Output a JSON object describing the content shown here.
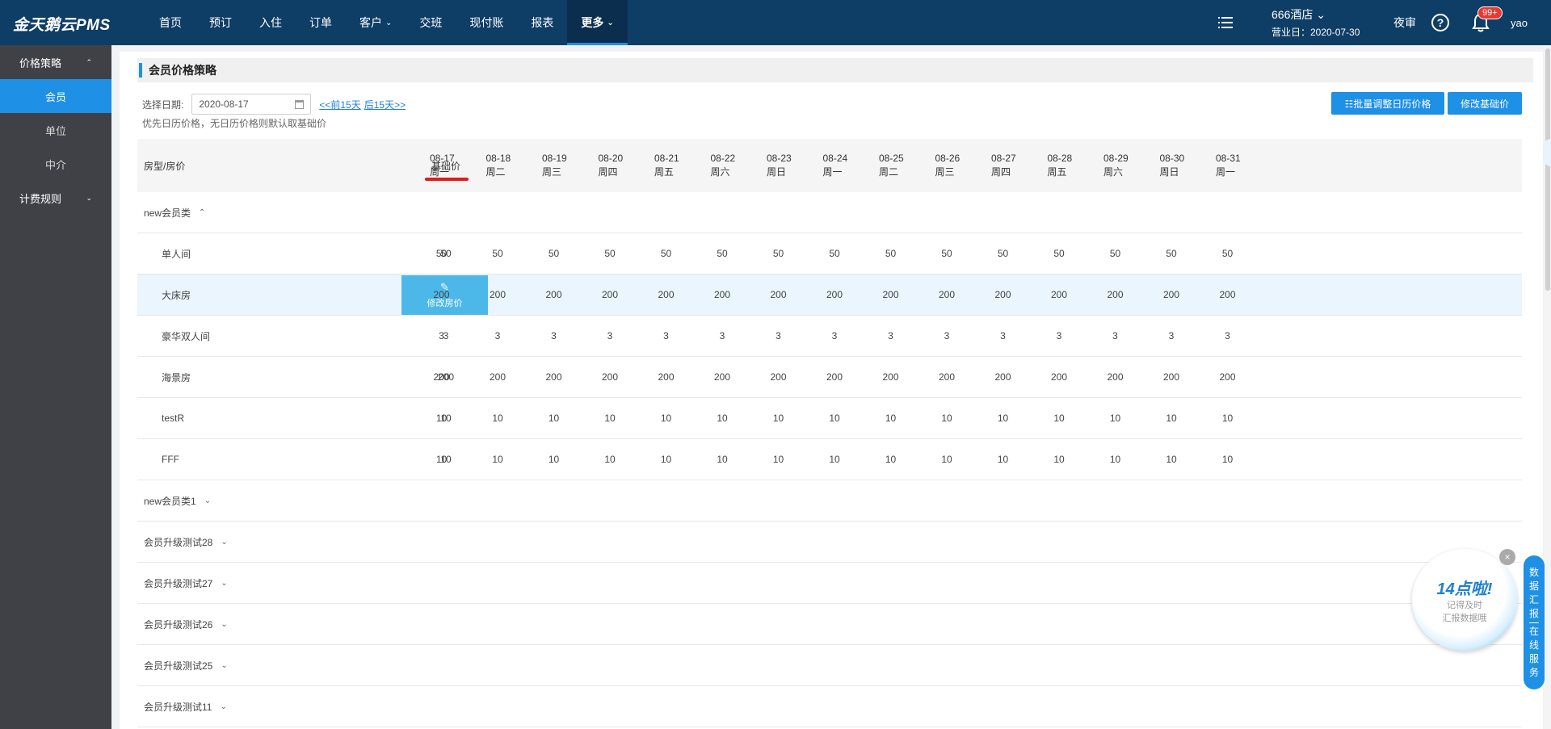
{
  "app": {
    "logo": "金天鹅云PMS"
  },
  "nav": [
    {
      "label": "首页",
      "caret": ""
    },
    {
      "label": "预订",
      "caret": ""
    },
    {
      "label": "入住",
      "caret": ""
    },
    {
      "label": "订单",
      "caret": ""
    },
    {
      "label": "客户",
      "caret": "⌄"
    },
    {
      "label": "交班",
      "caret": ""
    },
    {
      "label": "现付账",
      "caret": ""
    },
    {
      "label": "报表",
      "caret": ""
    },
    {
      "label": "更多",
      "caret": "⌄",
      "active": true
    }
  ],
  "topbar": {
    "hotel_name": "666酒店 ⌄",
    "business_day": "营业日：2020-07-30",
    "night_audit": "夜审",
    "help": "?",
    "badge": "99+",
    "user": "yao"
  },
  "sidebar": {
    "groups": [
      {
        "label": "价格策略",
        "caret": "⌃",
        "items": [
          "会员",
          "单位",
          "中介"
        ]
      },
      {
        "label": "计费规则",
        "caret": "⌄",
        "items": []
      }
    ],
    "active_item": "会员"
  },
  "page": {
    "title": "会员价格策略",
    "date_label": "选择日期:",
    "date_value": "2020-08-17",
    "prev_link": "<<前15天",
    "next_link": "后15天>>",
    "hint": "优先日历价格，无日历价格则默认取基础价",
    "batch_button": "☷批量调整日历价格",
    "base_button": "修改基础价"
  },
  "table": {
    "col_roomtype": "房型/房价",
    "col_base": "基础价",
    "dates": [
      {
        "date": "08-17",
        "weekday": "周一"
      },
      {
        "date": "08-18",
        "weekday": "周二"
      },
      {
        "date": "08-19",
        "weekday": "周三"
      },
      {
        "date": "08-20",
        "weekday": "周四"
      },
      {
        "date": "08-21",
        "weekday": "周五"
      },
      {
        "date": "08-22",
        "weekday": "周六"
      },
      {
        "date": "08-23",
        "weekday": "周日"
      },
      {
        "date": "08-24",
        "weekday": "周一"
      },
      {
        "date": "08-25",
        "weekday": "周二"
      },
      {
        "date": "08-26",
        "weekday": "周三"
      },
      {
        "date": "08-27",
        "weekday": "周四"
      },
      {
        "date": "08-28",
        "weekday": "周五"
      },
      {
        "date": "08-29",
        "weekday": "周六"
      },
      {
        "date": "08-30",
        "weekday": "周日"
      },
      {
        "date": "08-31",
        "weekday": "周一"
      }
    ],
    "edit_label": "修改房价",
    "expanded_group": {
      "name": "new会员类",
      "caret": "⌃"
    },
    "rooms": [
      {
        "name": "单人间",
        "base": "50",
        "values": [
          "50",
          "50",
          "50",
          "50",
          "50",
          "50",
          "50",
          "50",
          "50",
          "50",
          "50",
          "50",
          "50",
          "50",
          "50"
        ]
      },
      {
        "name": "大床房",
        "base": "200",
        "values": [
          "200",
          "200",
          "200",
          "200",
          "200",
          "200",
          "200",
          "200",
          "200",
          "200",
          "200",
          "200",
          "200",
          "200",
          "200"
        ],
        "highlight": true
      },
      {
        "name": "豪华双人间",
        "base": "3",
        "values": [
          "3",
          "3",
          "3",
          "3",
          "3",
          "3",
          "3",
          "3",
          "3",
          "3",
          "3",
          "3",
          "3",
          "3",
          "3"
        ]
      },
      {
        "name": "海景房",
        "base": "200",
        "values": [
          "200",
          "200",
          "200",
          "200",
          "200",
          "200",
          "200",
          "200",
          "200",
          "200",
          "200",
          "200",
          "200",
          "200",
          "200"
        ]
      },
      {
        "name": "testR",
        "base": "10",
        "values": [
          "10",
          "10",
          "10",
          "10",
          "10",
          "10",
          "10",
          "10",
          "10",
          "10",
          "10",
          "10",
          "10",
          "10",
          "10"
        ]
      },
      {
        "name": "FFF",
        "base": "10",
        "values": [
          "10",
          "10",
          "10",
          "10",
          "10",
          "10",
          "10",
          "10",
          "10",
          "10",
          "10",
          "10",
          "10",
          "10",
          "10"
        ]
      }
    ],
    "collapsed_groups": [
      {
        "name": "new会员类1",
        "caret": "⌄"
      },
      {
        "name": "会员升级测试28",
        "caret": "⌄"
      },
      {
        "name": "会员升级测试27",
        "caret": "⌄"
      },
      {
        "name": "会员升级测试26",
        "caret": "⌄"
      },
      {
        "name": "会员升级测试25",
        "caret": "⌄"
      },
      {
        "name": "会员升级测试11",
        "caret": "⌄"
      }
    ]
  },
  "promo": {
    "big": "14点啦!",
    "line1": "记得及时",
    "line2": "汇报数据哦",
    "close": "×"
  },
  "service": {
    "top_chars": [
      "数",
      "据",
      "汇",
      "报"
    ],
    "bottom_chars": [
      "在",
      "线",
      "服",
      "务"
    ]
  },
  "colors": {
    "topbar": "#0e3d66",
    "accent": "#1e90e6",
    "sidebar": "#3f4146",
    "highlight": "#4cb8ea"
  }
}
